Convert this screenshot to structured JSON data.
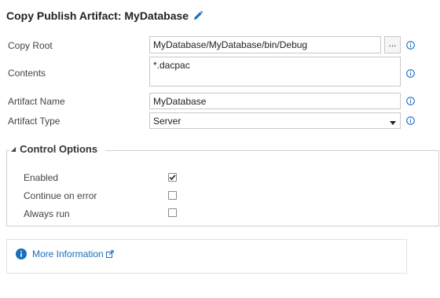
{
  "header": {
    "title": "Copy Publish Artifact: MyDatabase",
    "edit_icon": "pencil-icon"
  },
  "fields": {
    "copy_root": {
      "label": "Copy Root",
      "value": "MyDatabase/MyDatabase/bin/Debug",
      "browse_label": "..."
    },
    "contents": {
      "label": "Contents",
      "value": "*.dacpac"
    },
    "artifact_name": {
      "label": "Artifact Name",
      "value": "MyDatabase"
    },
    "artifact_type": {
      "label": "Artifact Type",
      "value": "Server"
    }
  },
  "control_options": {
    "title": "Control Options",
    "items": [
      {
        "label": "Enabled",
        "checked": true
      },
      {
        "label": "Continue on error",
        "checked": false
      },
      {
        "label": "Always run",
        "checked": false
      }
    ]
  },
  "more_info": {
    "label": "More Information",
    "icon": "info-icon",
    "external_icon": "external-link-icon"
  },
  "colors": {
    "accent": "#1a6ebd",
    "border": "#c8c8c8"
  }
}
